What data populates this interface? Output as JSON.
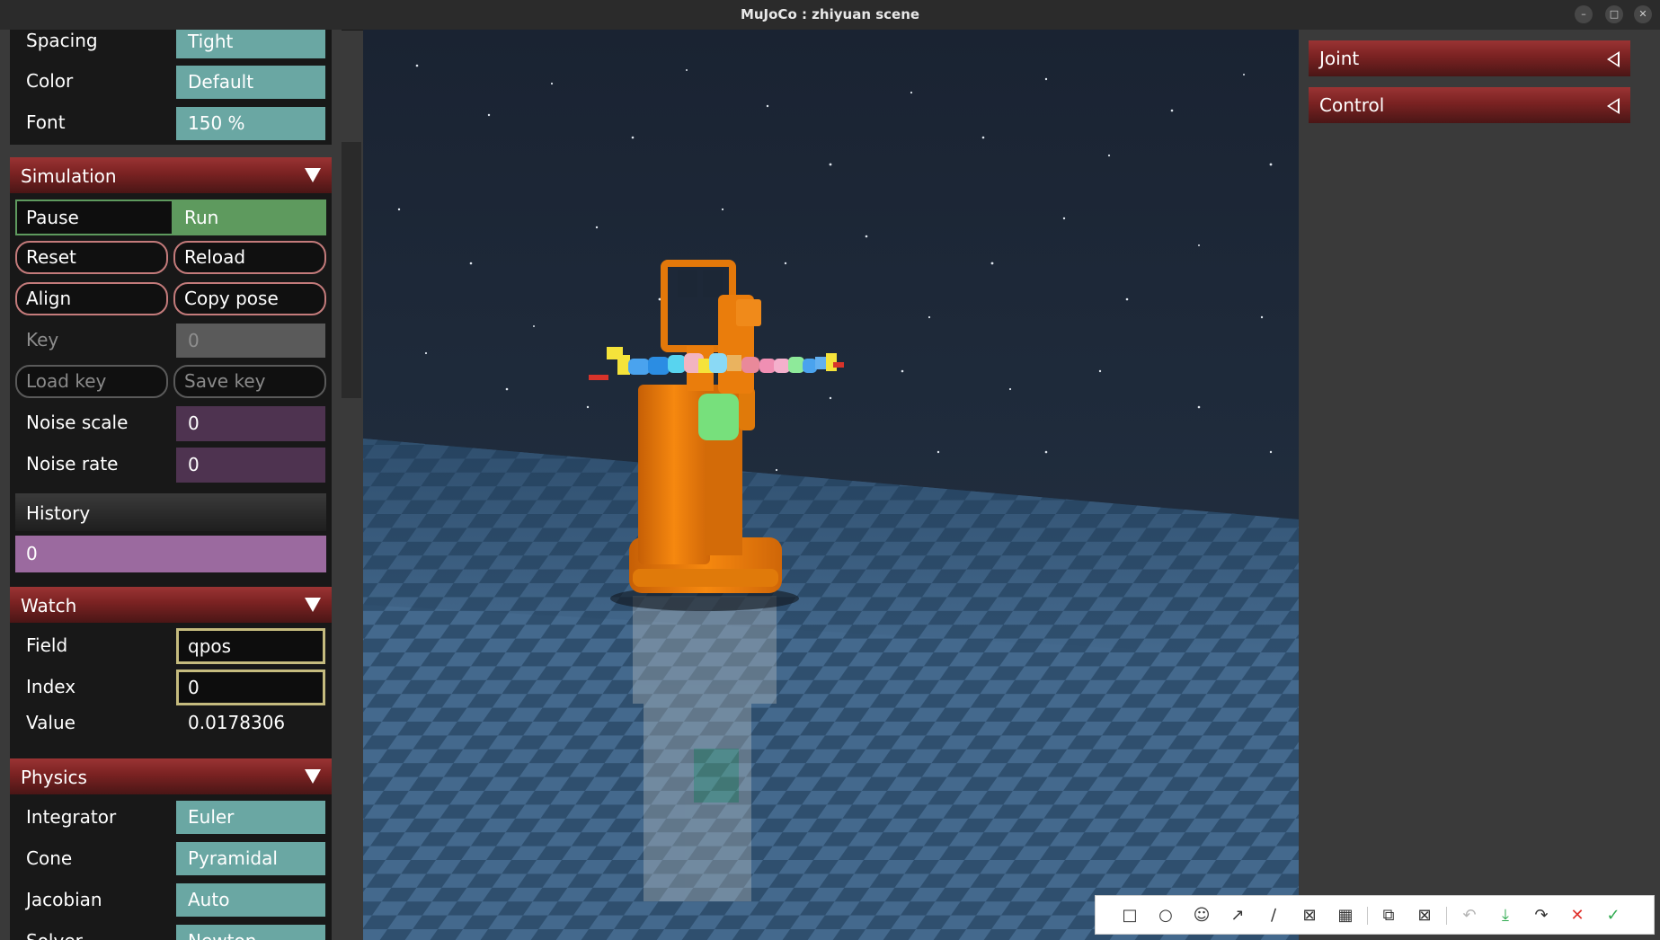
{
  "window": {
    "title": "MuJoCo : zhiyuan scene",
    "controls": [
      "minimize-icon",
      "maximize-icon",
      "close-icon"
    ]
  },
  "rendering": {
    "spacing_label": "Spacing",
    "spacing_value": "Tight",
    "color_label": "Color",
    "color_value": "Default",
    "font_label": "Font",
    "font_value": "150 %"
  },
  "simulation": {
    "title": "Simulation",
    "pause_label": "Pause",
    "run_label": "Run",
    "reset_label": "Reset",
    "reload_label": "Reload",
    "align_label": "Align",
    "copy_pose_label": "Copy pose",
    "key_label": "Key",
    "key_value": "0",
    "load_key_label": "Load key",
    "save_key_label": "Save key",
    "noise_scale_label": "Noise scale",
    "noise_scale_value": "0",
    "noise_rate_label": "Noise rate",
    "noise_rate_value": "0",
    "history_label": "History",
    "history_value": "0"
  },
  "watch": {
    "title": "Watch",
    "field_label": "Field",
    "field_value": "qpos",
    "index_label": "Index",
    "index_value": "0",
    "value_label": "Value",
    "value_value": "0.0178306"
  },
  "physics": {
    "title": "Physics",
    "integrator_label": "Integrator",
    "integrator_value": "Euler",
    "cone_label": "Cone",
    "cone_value": "Pyramidal",
    "jacobian_label": "Jacobian",
    "jacobian_value": "Auto",
    "solver_label": "Solver",
    "solver_value": "Newton"
  },
  "right_panel": {
    "joint_label": "Joint",
    "control_label": "Control"
  },
  "toolbar": {
    "tools": [
      "rectangle-icon",
      "circle-icon",
      "emoji-icon",
      "arrow-icon",
      "line-icon",
      "mosaic-icon",
      "text-icon",
      "pin-icon",
      "blur-icon",
      "undo-icon",
      "save-icon",
      "share-icon",
      "cancel-icon",
      "confirm-icon"
    ]
  },
  "colors": {
    "header_red": "#8a2a2a",
    "teal": "#6aa7a3",
    "run_green": "#5e9a5e",
    "history_purple": "#9b6a9f",
    "noise_field": "#4e3350",
    "robot_orange": "#f07f0c",
    "sky": "#1c2736"
  }
}
